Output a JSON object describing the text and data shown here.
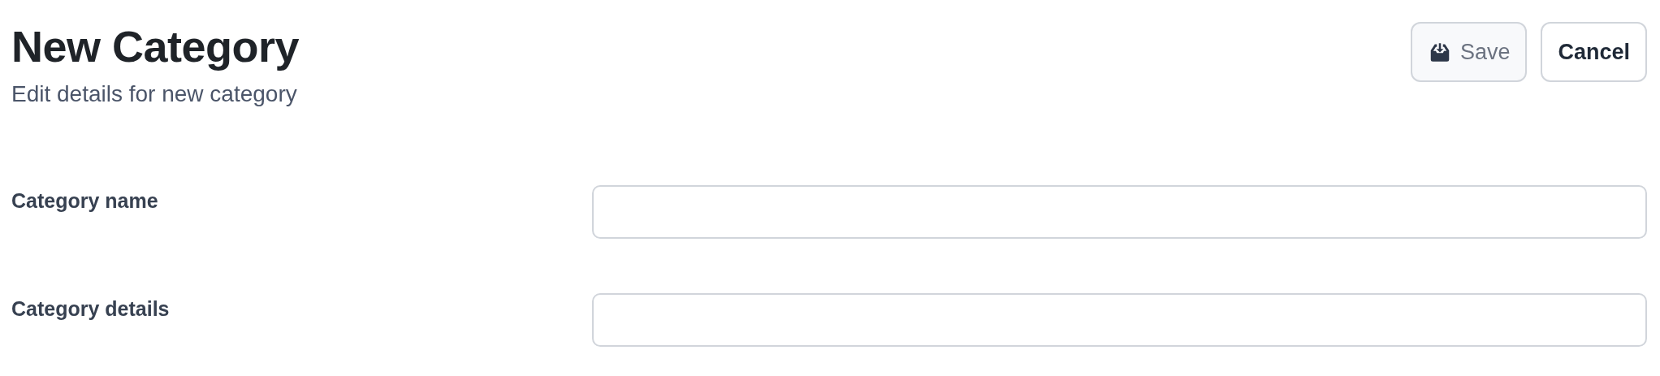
{
  "header": {
    "title": "New Category",
    "subtitle": "Edit details for new category"
  },
  "buttons": [
    {
      "kind": "save",
      "label": "Save",
      "disabled": true
    },
    {
      "kind": "cancel",
      "label": "Cancel",
      "disabled": false
    }
  ],
  "fields": [
    {
      "label": "Category name"
    },
    {
      "label": "Category details"
    }
  ]
}
